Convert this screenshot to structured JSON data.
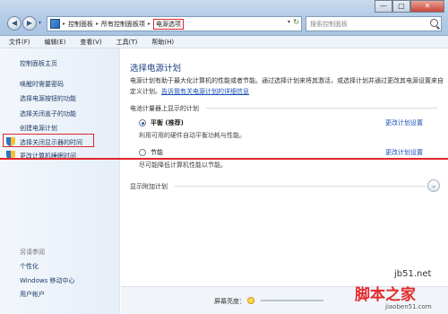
{
  "window": {
    "min": "—",
    "max": "□",
    "close": "✕"
  },
  "nav": {
    "back": "◀",
    "forward": "▶",
    "dropdown": "▾"
  },
  "address": {
    "crumbs": [
      "控制面板",
      "所有控制面板项",
      "电源选项"
    ],
    "separator": "▸",
    "refresh": "↻",
    "dropdown": "▾"
  },
  "search": {
    "placeholder": "搜索控制面板"
  },
  "menu": [
    "文件(F)",
    "编辑(E)",
    "查看(V)",
    "工具(T)",
    "帮助(H)"
  ],
  "sidebar": {
    "home": "控制面板主页",
    "items": [
      "唤醒时需要密码",
      "选择电源按钮的功能",
      "选择关闭盖子的功能",
      "创建电源计划",
      "选择关闭显示器的时间",
      "更改计算机睡眠时间"
    ],
    "see_also": "另请参阅",
    "see_also_items": [
      "个性化",
      "Windows 移动中心",
      "用户帐户"
    ]
  },
  "main": {
    "heading": "选择电源计划",
    "desc_a": "电源计划有助于最大化计算机的性能或者节能。通过选择计划来将其激活，或选择计划并通过更改其电源设置来自定义计划。",
    "desc_link": "告诉我有关电源计划的详细信息",
    "group_label": "电池计量器上显示的计划",
    "plans": [
      {
        "name": "平衡 (推荐)",
        "desc": "利用可用的硬件自动平衡功耗与性能。",
        "link": "更改计划设置",
        "selected": true
      },
      {
        "name": "节能",
        "desc": "尽可能降低计算机性能以节能。",
        "link": "更改计划设置",
        "selected": false
      }
    ],
    "more_label": "显示附加计划",
    "expand": "⌄",
    "brightness_label": "屏幕亮度："
  },
  "watermark": {
    "site": "jb51.net",
    "brand": "脚本之家",
    "url": "jiaoben51.com"
  },
  "colors": {
    "highlight": "#e0252b",
    "link": "#1a4fb5",
    "heading": "#1b3f85"
  }
}
